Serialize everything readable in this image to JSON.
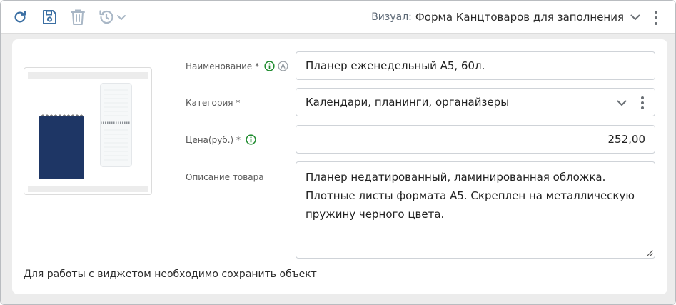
{
  "toolbar": {
    "refresh_icon": "refresh-icon",
    "save_icon": "save-icon",
    "delete_icon": "trash-icon",
    "history_icon": "history-icon",
    "visual_prefix": "Визуал:",
    "visual_value": "Форма Канцтоваров для заполнения"
  },
  "product": {
    "image_alt": "Планер еженедельный А5"
  },
  "form": {
    "name_label": "Наименование *",
    "name_value": "Планер еженедельный А5, 60л.",
    "category_label": "Категория *",
    "category_value": "Календари, планинги, органайзеры",
    "price_label": "Цена(руб.) *",
    "price_value": "252,00",
    "description_label": "Описание товара",
    "description_lines": [
      "Планер недатированный, ламинированная обложка.",
      "Плотные листы формата А5. Скреплен на металлическую",
      "пружину черного цвета."
    ]
  },
  "footer_note": "Для работы с виджетом необходимо сохранить объект",
  "colors": {
    "accent_green": "#1d8a2d",
    "icon_blue": "#3b6fa3",
    "icon_disabled": "#a9b7c6",
    "notebook_navy": "#1e3665"
  }
}
